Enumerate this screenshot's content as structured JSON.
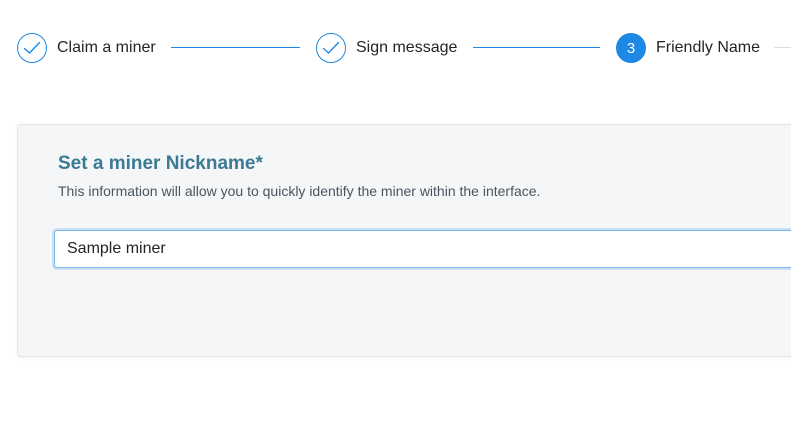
{
  "stepper": {
    "steps": [
      {
        "label": "Claim a miner",
        "status": "done",
        "icon": "checkmark-icon"
      },
      {
        "label": "Sign message",
        "status": "done",
        "icon": "checkmark-icon"
      },
      {
        "label": "Friendly Name",
        "status": "active",
        "number": "3"
      }
    ]
  },
  "form": {
    "title": "Set a miner Nickname*",
    "description": "This information will allow you to quickly identify the miner within the interface.",
    "nickname_value": "Sample miner"
  },
  "colors": {
    "accent": "#1e88e5",
    "title": "#3b7a93",
    "card_background": "#f5f6f8"
  }
}
